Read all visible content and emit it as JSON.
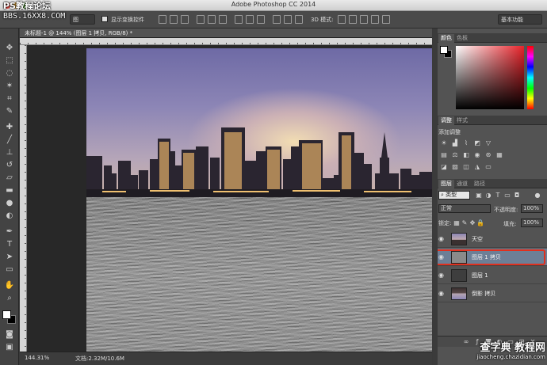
{
  "app": {
    "title": "Adobe Photoshop CC 2014",
    "watermark_top_line1": "PS教程论坛",
    "watermark_top_line2": "BBS.16XX8.COM"
  },
  "options_bar": {
    "transform_controls_label": "显示变换控件",
    "mode_3d_label": "3D 模式:",
    "workspace_value": "基本功能",
    "align_value": "图"
  },
  "document": {
    "tab_title": "未标题-1 @ 144% (图层 1 拷贝, RGB/8) *",
    "zoom": "144.31%",
    "doc_info": "文档:2.32M/10.6M"
  },
  "panels": {
    "color_tabs": [
      "颜色",
      "色板"
    ],
    "adjust_tabs": [
      "调整",
      "样式"
    ],
    "adjust_title": "添加调整",
    "layer_tabs": [
      "图层",
      "通道",
      "路径"
    ],
    "kind_filter": "类型",
    "blend_mode": "正常",
    "opacity_label": "不透明度:",
    "opacity_value": "100%",
    "lock_label": "锁定:",
    "fill_label": "填充:",
    "fill_value": "100%"
  },
  "layers": [
    {
      "name": "天空",
      "selected": false,
      "thumb": "sky"
    },
    {
      "name": "图层 1 拷贝",
      "selected": true,
      "thumb": "gray"
    },
    {
      "name": "图层 1",
      "selected": false,
      "thumb": "dark"
    },
    {
      "name": "倒影 拷贝",
      "selected": false,
      "thumb": "city"
    }
  ],
  "watermark_bottom": {
    "line1": "查字典 教程网",
    "line2": "jiaocheng.chazidian.com"
  },
  "colors": {
    "selection_highlight": "#e0301e",
    "selected_layer_bg": "#6d7f96",
    "panel_bg": "#535353"
  }
}
